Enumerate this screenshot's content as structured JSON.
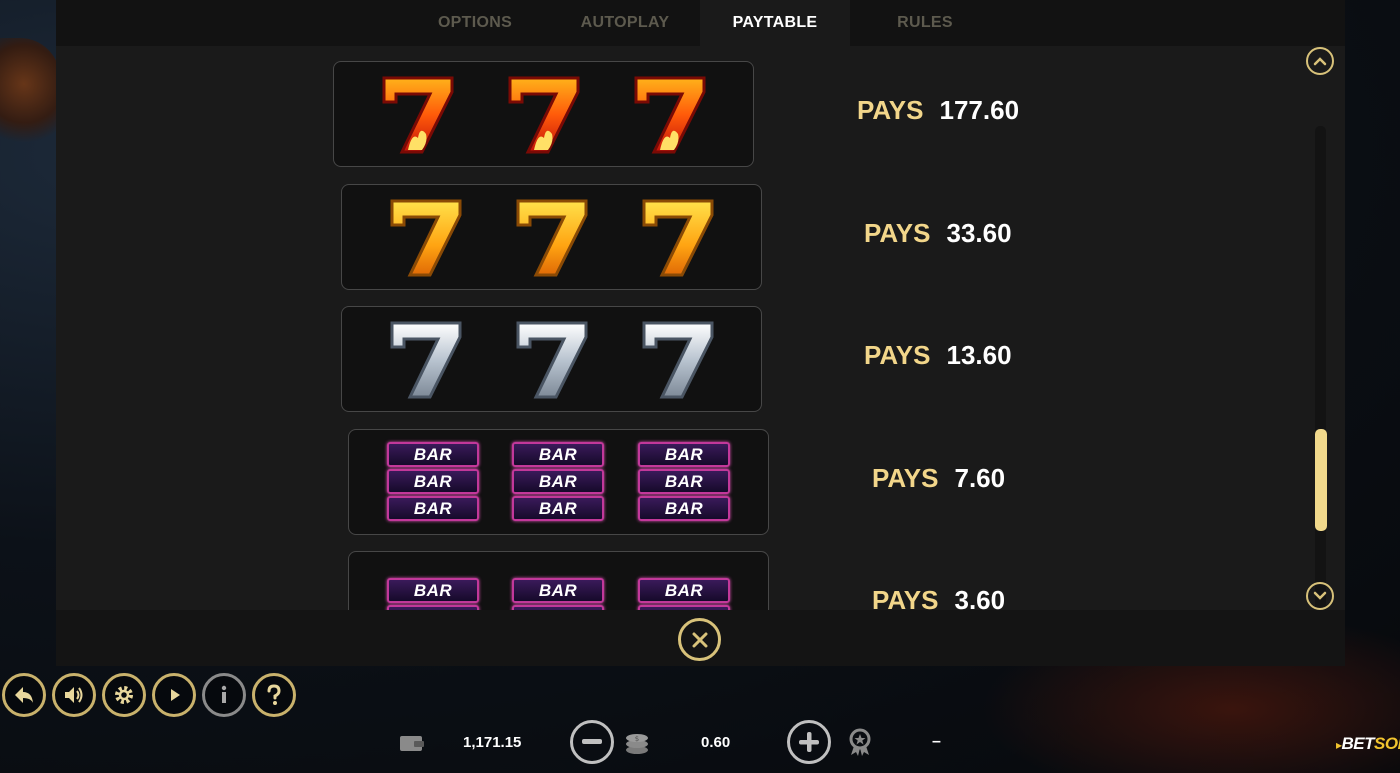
{
  "tabs": [
    {
      "label": "OPTIONS",
      "active": false
    },
    {
      "label": "AUTOPLAY",
      "active": false
    },
    {
      "label": "PAYTABLE",
      "active": true
    },
    {
      "label": "RULES",
      "active": false
    }
  ],
  "paytable": {
    "rows": [
      {
        "symbol": "fire-seven",
        "count": 3,
        "pays_label": "PAYS",
        "pays_value": "177.60"
      },
      {
        "symbol": "gold-seven",
        "count": 3,
        "pays_label": "PAYS",
        "pays_value": "33.60"
      },
      {
        "symbol": "silver-seven",
        "count": 3,
        "pays_label": "PAYS",
        "pays_value": "13.60"
      },
      {
        "symbol": "triple-bar",
        "count": 3,
        "pays_label": "PAYS",
        "pays_value": "7.60",
        "bar_label": "BAR"
      },
      {
        "symbol": "double-bar",
        "count": 3,
        "pays_label": "PAYS",
        "pays_value": "3.60",
        "bar_label": "BAR"
      }
    ],
    "scroll_position": 0.62
  },
  "hud": {
    "buttons": [
      "back-icon",
      "sound-icon",
      "settings-icon",
      "autoplay-icon",
      "info-icon",
      "help-icon"
    ],
    "balance": "1,171.15",
    "bet": "0.60",
    "win": "–",
    "brand_main": "BET",
    "brand_accent": "SOFT"
  },
  "colors": {
    "accent_gold": "#d8c27a",
    "pays_label": "#f2d68a",
    "bar_border": "#c2389a",
    "panel_bg": "#1a1a1a"
  }
}
